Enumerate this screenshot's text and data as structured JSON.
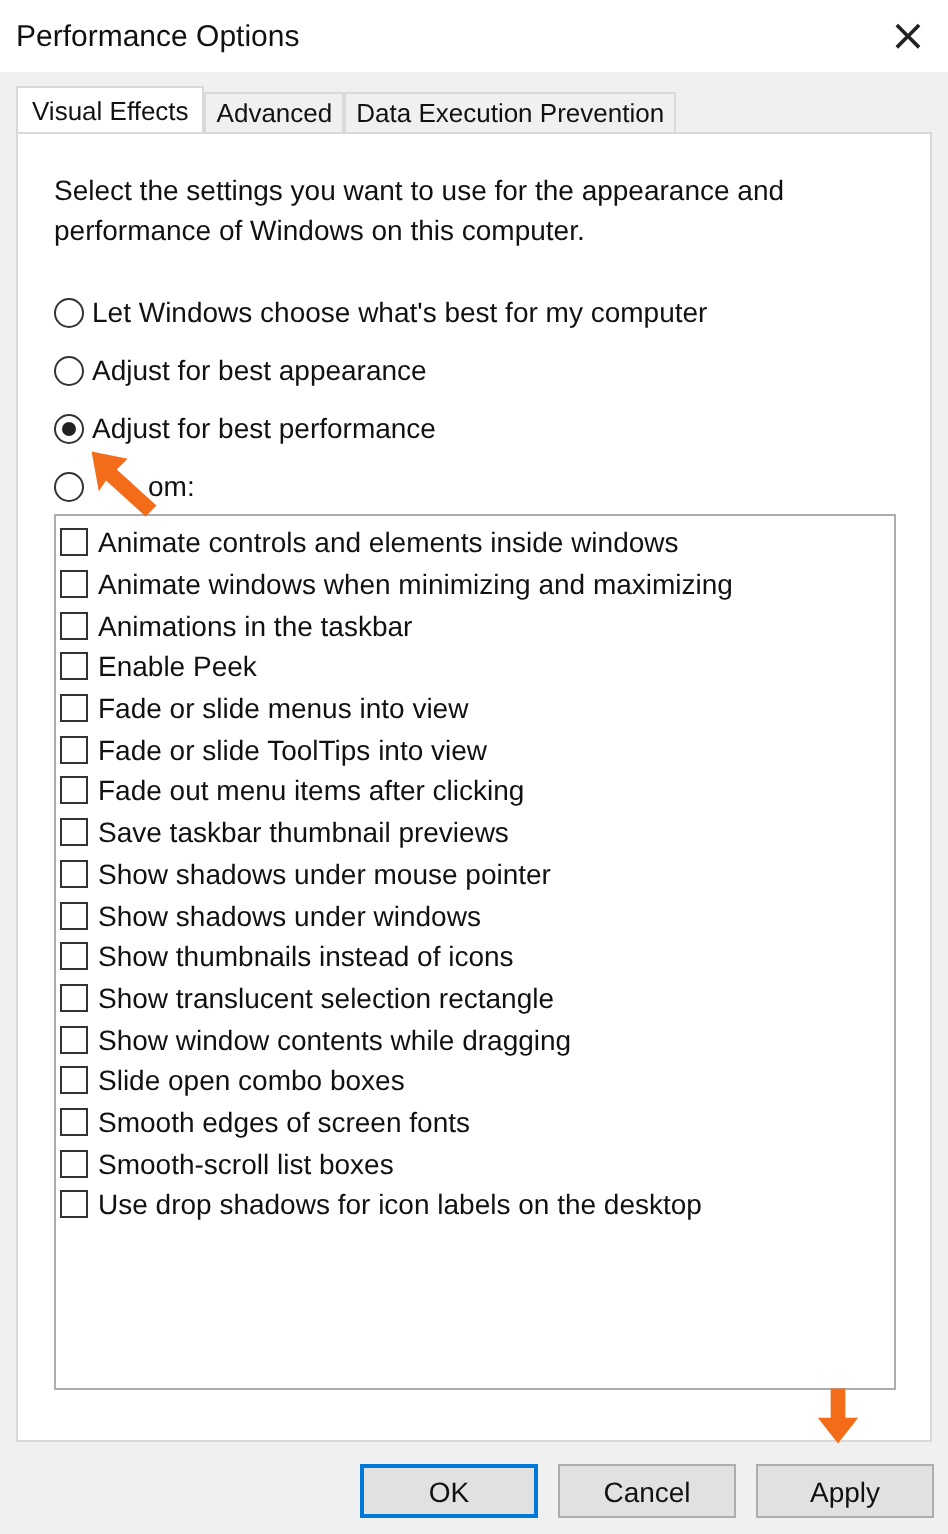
{
  "window": {
    "title": "Performance Options",
    "close": "×"
  },
  "tabs": [
    {
      "label": "Visual Effects",
      "selected": true
    },
    {
      "label": "Advanced",
      "selected": false
    },
    {
      "label": "Data Execution Prevention",
      "selected": false
    }
  ],
  "description": "Select the settings you want to use for the appearance and performance of Windows on this computer.",
  "options": [
    {
      "label": "Let Windows choose what's best for my computer",
      "selected": false
    },
    {
      "label": "Adjust for best appearance",
      "selected": false
    },
    {
      "label": "Adjust for best performance",
      "selected": true
    },
    {
      "label": "om:",
      "selected": false,
      "covered": true
    }
  ],
  "effects": [
    {
      "label": "Animate controls and elements inside windows",
      "checked": false
    },
    {
      "label": "Animate windows when minimizing and maximizing",
      "checked": false
    },
    {
      "label": "Animations in the taskbar",
      "checked": false
    },
    {
      "label": "Enable Peek",
      "checked": false
    },
    {
      "label": "Fade or slide menus into view",
      "checked": false
    },
    {
      "label": "Fade or slide ToolTips into view",
      "checked": false
    },
    {
      "label": "Fade out menu items after clicking",
      "checked": false
    },
    {
      "label": "Save taskbar thumbnail previews",
      "checked": false
    },
    {
      "label": "Show shadows under mouse pointer",
      "checked": false
    },
    {
      "label": "Show shadows under windows",
      "checked": false
    },
    {
      "label": "Show thumbnails instead of icons",
      "checked": false
    },
    {
      "label": "Show translucent selection rectangle",
      "checked": false
    },
    {
      "label": "Show window contents while dragging",
      "checked": false
    },
    {
      "label": "Slide open combo boxes",
      "checked": false
    },
    {
      "label": "Smooth edges of screen fonts",
      "checked": false
    },
    {
      "label": "Smooth-scroll list boxes",
      "checked": false
    },
    {
      "label": "Use drop shadows for icon labels on the desktop",
      "checked": false
    }
  ],
  "buttons": [
    {
      "label": "OK",
      "kind": "default"
    },
    {
      "label": "Cancel",
      "kind": "normal"
    },
    {
      "label": "Apply",
      "kind": "normal"
    }
  ]
}
